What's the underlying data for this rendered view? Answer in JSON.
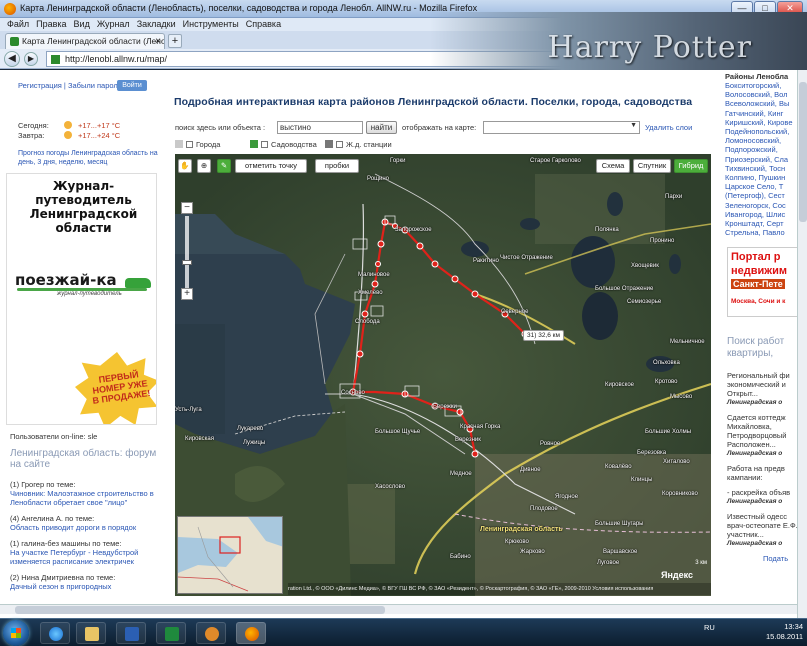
{
  "window": {
    "title": "Карта Ленинградской области (Ленобласть), поселки, садоводства и города Ленобл. AllNW.ru - Mozilla Firefox",
    "minimize": "—",
    "maximize": "□",
    "close": "✕"
  },
  "menu": [
    "Файл",
    "Правка",
    "Вид",
    "Журнал",
    "Закладки",
    "Инструменты",
    "Справка"
  ],
  "theme_banner": "Harry Potter",
  "tab": {
    "label": "Карта Ленинградской области (Лено...",
    "close": "×",
    "new": "+"
  },
  "nav": {
    "url": "http://lenobl.allnw.ru/map/",
    "search_placeholder": "Google"
  },
  "left": {
    "register": "Регистрация | Забыли пароль?",
    "login": "Войти",
    "weather": [
      {
        "day": "Сегодня:",
        "temp": "+17...+17 °C"
      },
      {
        "day": "Завтра:",
        "temp": "+17...+24 °C"
      }
    ],
    "forecast": "Прогноз погоды Ленинградская область на день, 3 дня, неделю, месяц",
    "journal": {
      "title": "Журнал-путеводитель Ленинградской области",
      "logo": "поезжай-ка",
      "logo_sub": "журнал-путеводитель",
      "burst": "ПЕРВЫЙ НОМЕР УЖЕ В ПРОДАЖЕ!"
    },
    "online": "Пользователи on-line: sle",
    "forum_title": "Ленинградская область: форум на сайте",
    "forum": [
      {
        "who": "(1) Грогер по теме:",
        "msg": "Чиновник: Малоэтажное строительство в Ленобласти обретает свое \"лицо\""
      },
      {
        "who": "(4) Ангелина А. по теме:",
        "msg": "Область приводит дороги в порядок"
      },
      {
        "who": "(1) галина-без машины по теме:",
        "msg": "На участке Петербург - Невдубстрой изменяется расписание электричек"
      },
      {
        "who": "(2) Нина Дмитриевна по теме:",
        "msg": "Дачный сезон в пригородных"
      }
    ]
  },
  "main": {
    "title": "Подробная интерактивная карта районов Ленинградской области. Поселки, города, садоводства",
    "search_label": "поиск здесь или объекта :",
    "search_value": "выстино",
    "search_button": "найти",
    "show_label": "отображать на карте:",
    "delete_link": "Удалить слои",
    "filters": [
      "Города",
      "Садоводства",
      "Ж.д. станции"
    ]
  },
  "map": {
    "buttons": {
      "mark": "отметить точку",
      "route": "пробки",
      "scheme": "Схема",
      "satellite": "Спутник",
      "hybrid": "Гибрид"
    },
    "zoom_in": "+",
    "zoom_out": "−",
    "distance": "31) 32,6 км",
    "region_label": "Ленинградская область",
    "logo": "Яндекс",
    "scale": "3 км",
    "copyright": "ration Ltd., © ООО «Дилинс Медиа», © ВГУ ГШ ВС РФ, © ЗАО «Резидент», © Роскартография, © ЗАО «ГЕ», 2009-2010 Условия использования",
    "labels": [
      "Горки",
      "Старое Гарколово",
      "Рощино",
      "Полянка",
      "Пархи",
      "Чистое Отражение",
      "Большое Отражение",
      "Пронино",
      "Запорожское",
      "Хвощевик",
      "Малиновое",
      "Северное",
      "Семиозерье",
      "Бережки",
      "Ракитино",
      "Хмелёво",
      "Слобода",
      "Большое Щучье",
      "Сосново",
      "Ольховка",
      "Кротово",
      "Красная Горка",
      "Большие Холмы",
      "Березовка",
      "Ровное",
      "Дивное",
      "Березник",
      "Большие Шугары",
      "Плодовое",
      "Варшавское",
      "Коровниково",
      "Бабино",
      "Мысово",
      "Луговое",
      "Ягодное",
      "Лукарево",
      "Крюково",
      "Усть-Луга",
      "Ковалёво",
      "Хиталово",
      "Клинцы",
      "Мельничное",
      "Кировская",
      "Жарково",
      "Хасослово",
      "Лужицы",
      "Кировское",
      "Медное"
    ]
  },
  "right": {
    "header": "Районы Ленобла",
    "districts": [
      "Бокситогорский,",
      "Волосовский, Вол",
      "Всеволожский, Вы",
      "Гатчинский, Кинг",
      "Киришский, Кирове",
      "Подейнопольский,",
      "Ломоносовский,",
      "Подпорожский,",
      "Приозерский, Сла",
      "Тихвинский, Тосн",
      "Колпино, Пушкин",
      "Царское Село, Т",
      "(Петергоф), Сест",
      "Зеленогорск, Сос",
      "Ивангород, Шлис",
      "Кронштадт, Серт",
      "Стрельна, Павло"
    ],
    "portal": {
      "l1": "Портал р",
      "l2": "недвижим",
      "l3": "Санкт-Пете",
      "l4": "Москва, Сочи и к"
    },
    "search_head": "Поиск работ квартиры,",
    "news": [
      {
        "text": "Региональный фи экономический и Открыт...",
        "src": "Ленинградская о"
      },
      {
        "text": "Сдается коттедж Михайловка, Петродворцовый Расположен...",
        "src": "Ленинградская о"
      },
      {
        "text": "Работа на предв кампании:",
        "src": ""
      },
      {
        "text": "- раскрейка объяв",
        "src": "Ленинградская о"
      },
      {
        "text": "Известный одесс врач-остеопате Е.Ф. участник...",
        "src": "Ленинградская о"
      }
    ],
    "more": "Подать"
  },
  "taskbar": {
    "lang": "RU",
    "time": "13:34",
    "date": "15.08.2011"
  },
  "colors": {
    "route": "#e0221a",
    "hybrid_active": "#4cae3b",
    "title": "#1b3b6b",
    "link": "#2a56b4"
  }
}
